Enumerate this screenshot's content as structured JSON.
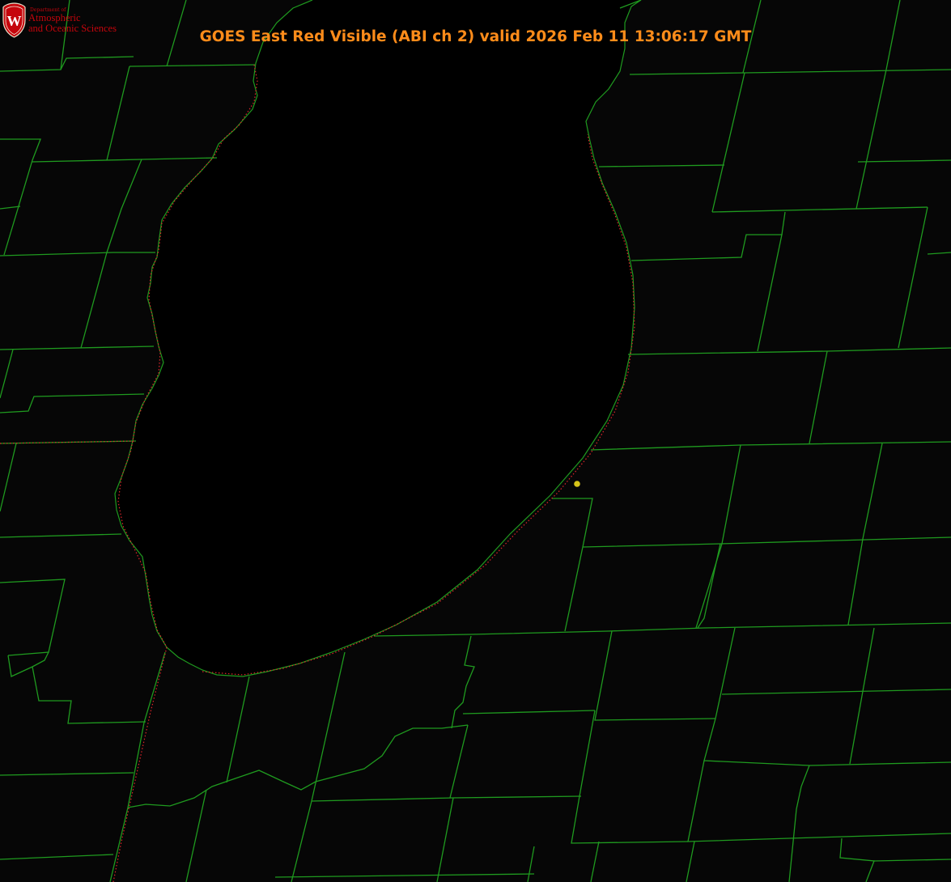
{
  "title": {
    "text": "GOES East Red Visible (ABI ch 2) valid 2026 Feb 11 13:06:17 GMT",
    "color": "#ff8c1a"
  },
  "logo": {
    "dept_text": "Department of",
    "line1": "Atmospheric",
    "line2": "and Oceanic Sciences",
    "shield_letter": "W",
    "color": "#c5050c"
  },
  "map": {
    "background": "#060606",
    "lake_fill": "#000000",
    "boundary_color": "#1f9a1f",
    "state_border_color": "#e0262b",
    "marker_color": "#d6c419",
    "marker_icon": "location-dot-icon"
  }
}
